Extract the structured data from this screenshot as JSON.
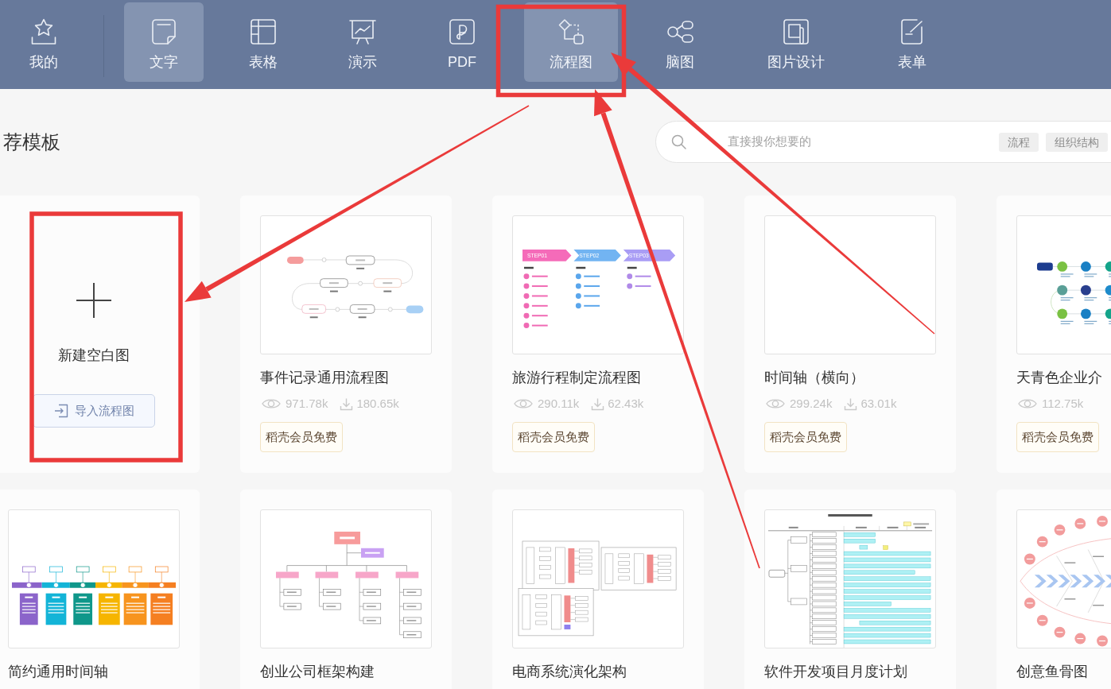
{
  "tabs": [
    {
      "kind": "favorites",
      "label": "我的",
      "selected": false
    },
    {
      "kind": "document",
      "label": "文字",
      "selected": true
    },
    {
      "kind": "sheet",
      "label": "表格",
      "selected": false
    },
    {
      "kind": "slides",
      "label": "演示",
      "selected": false
    },
    {
      "kind": "pdf",
      "label": "PDF",
      "selected": false
    },
    {
      "kind": "flowchart",
      "label": "流程图",
      "selected": true
    },
    {
      "kind": "mindmap",
      "label": "脑图",
      "selected": false
    },
    {
      "kind": "design",
      "label": "图片设计",
      "selected": false
    },
    {
      "kind": "form",
      "label": "表单",
      "selected": false
    }
  ],
  "heading": "荐模板",
  "search": {
    "placeholder": "直接搜你想要的",
    "tags": [
      "流程",
      "组织结构"
    ]
  },
  "new_blank": {
    "label": "新建空白图",
    "import_button": "导入流程图"
  },
  "templates": [
    {
      "title": "事件记录通用流程图",
      "views": "971.78k",
      "downloads": "180.65k",
      "badge": "稻壳会员免费",
      "preview": {
        "kind": "loop"
      }
    },
    {
      "title": "旅游行程制定流程图",
      "views": "290.11k",
      "downloads": "62.43k",
      "badge": "稻壳会员免费",
      "preview": {
        "kind": "steps",
        "labels": [
          "STEP01",
          "STEP02",
          "STEP03"
        ]
      }
    },
    {
      "title": "时间轴（横向）",
      "views": "299.24k",
      "downloads": "63.01k",
      "badge": "稻壳会员免费",
      "preview": {
        "kind": "blank"
      }
    },
    {
      "title": "天青色企业介",
      "views": "112.75k",
      "badge": "稻壳会员免费",
      "preview": {
        "kind": "dots"
      }
    },
    {
      "title": "简约通用时间轴",
      "preview": {
        "kind": "timeline"
      }
    },
    {
      "title": "创业公司框架构建",
      "preview": {
        "kind": "org"
      }
    },
    {
      "title": "电商系统演化架构",
      "preview": {
        "kind": "arch"
      }
    },
    {
      "title": "软件开发项目月度计划",
      "preview": {
        "kind": "gantt"
      }
    },
    {
      "title": "创意鱼骨图",
      "preview": {
        "kind": "fishbone"
      }
    }
  ],
  "annotations": [
    {
      "kind": "frame"
    },
    {
      "kind": "frame"
    },
    {
      "kind": "arrow"
    },
    {
      "kind": "arrow"
    },
    {
      "kind": "arrow"
    }
  ]
}
